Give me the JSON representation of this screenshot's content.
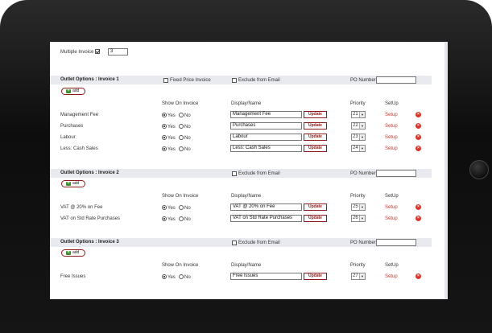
{
  "top": {
    "multiple_invoice_label": "Multiple Invoice",
    "multiple_invoice_checked": true,
    "invoice_count": "3"
  },
  "columns": {
    "show": "Show On Invoice",
    "display": "Display/Name",
    "priority": "Priority",
    "setup": "SetUp"
  },
  "common": {
    "add": "add",
    "yes": "Yes",
    "no": "No",
    "update": "Update",
    "setup_link": "Setup",
    "fixed_price": "Fixed Price Invoice",
    "exclude": "Exclude from Email",
    "po": "PO Number:"
  },
  "sections": [
    {
      "title": "Outlet Options : Invoice 1",
      "rows": [
        {
          "label": "Management Fee",
          "name": "Management Fee",
          "priority": "21"
        },
        {
          "label": "Purchases",
          "name": "Purchases",
          "priority": "22"
        },
        {
          "label": "Labour",
          "name": "Labour",
          "priority": "23"
        },
        {
          "label": "Less: Cash Sales",
          "name": "Less: Cash Sales",
          "priority": "24"
        }
      ]
    },
    {
      "title": "Outlet Options : Invoice 2",
      "rows": [
        {
          "label": "VAT @ 20% on Fee",
          "name": "VAT @ 20% on Fee",
          "priority": "25"
        },
        {
          "label": "VAT on Std Rate Purchases",
          "name": "VAT on Std Rate Purchases",
          "priority": "26"
        }
      ]
    },
    {
      "title": "Outlet Options : Invoice 3",
      "rows": [
        {
          "label": "Free Issues",
          "name": "Free Issues",
          "priority": "27"
        }
      ]
    }
  ]
}
